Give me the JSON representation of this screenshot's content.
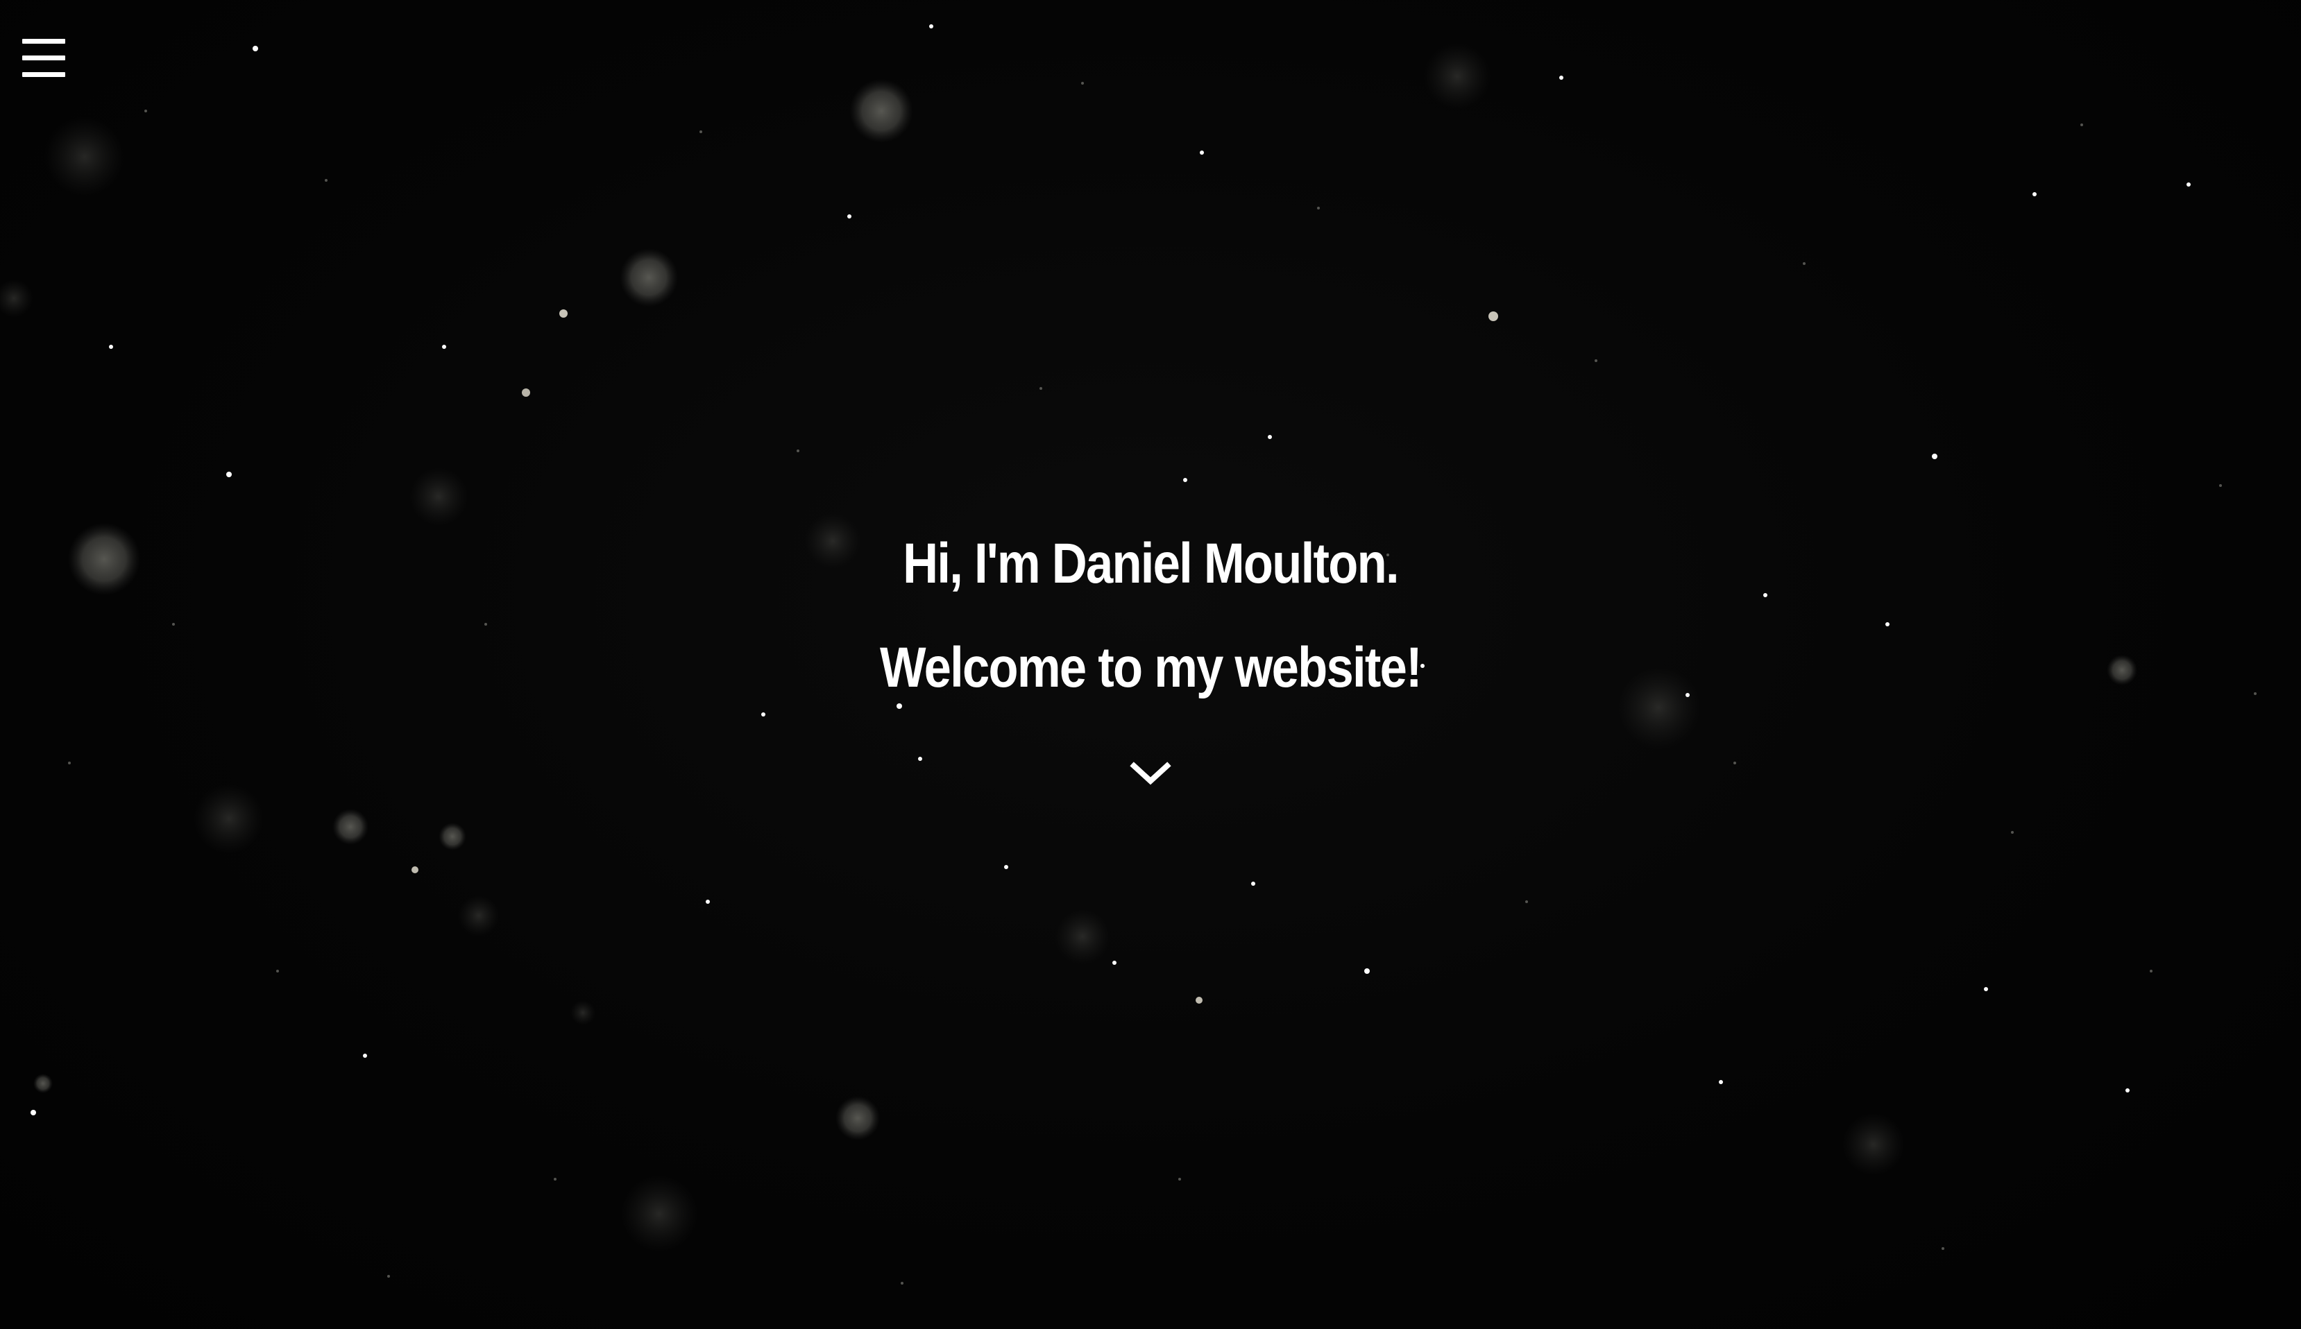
{
  "colors": {
    "background": "#030303",
    "text": "#ffffff"
  },
  "nav": {
    "menu_icon": "hamburger-menu-icon"
  },
  "hero": {
    "greeting": "Hi, I'm Daniel Moulton.",
    "welcome": "Welcome to my website!"
  },
  "scroll": {
    "icon": "chevron-down-icon"
  }
}
